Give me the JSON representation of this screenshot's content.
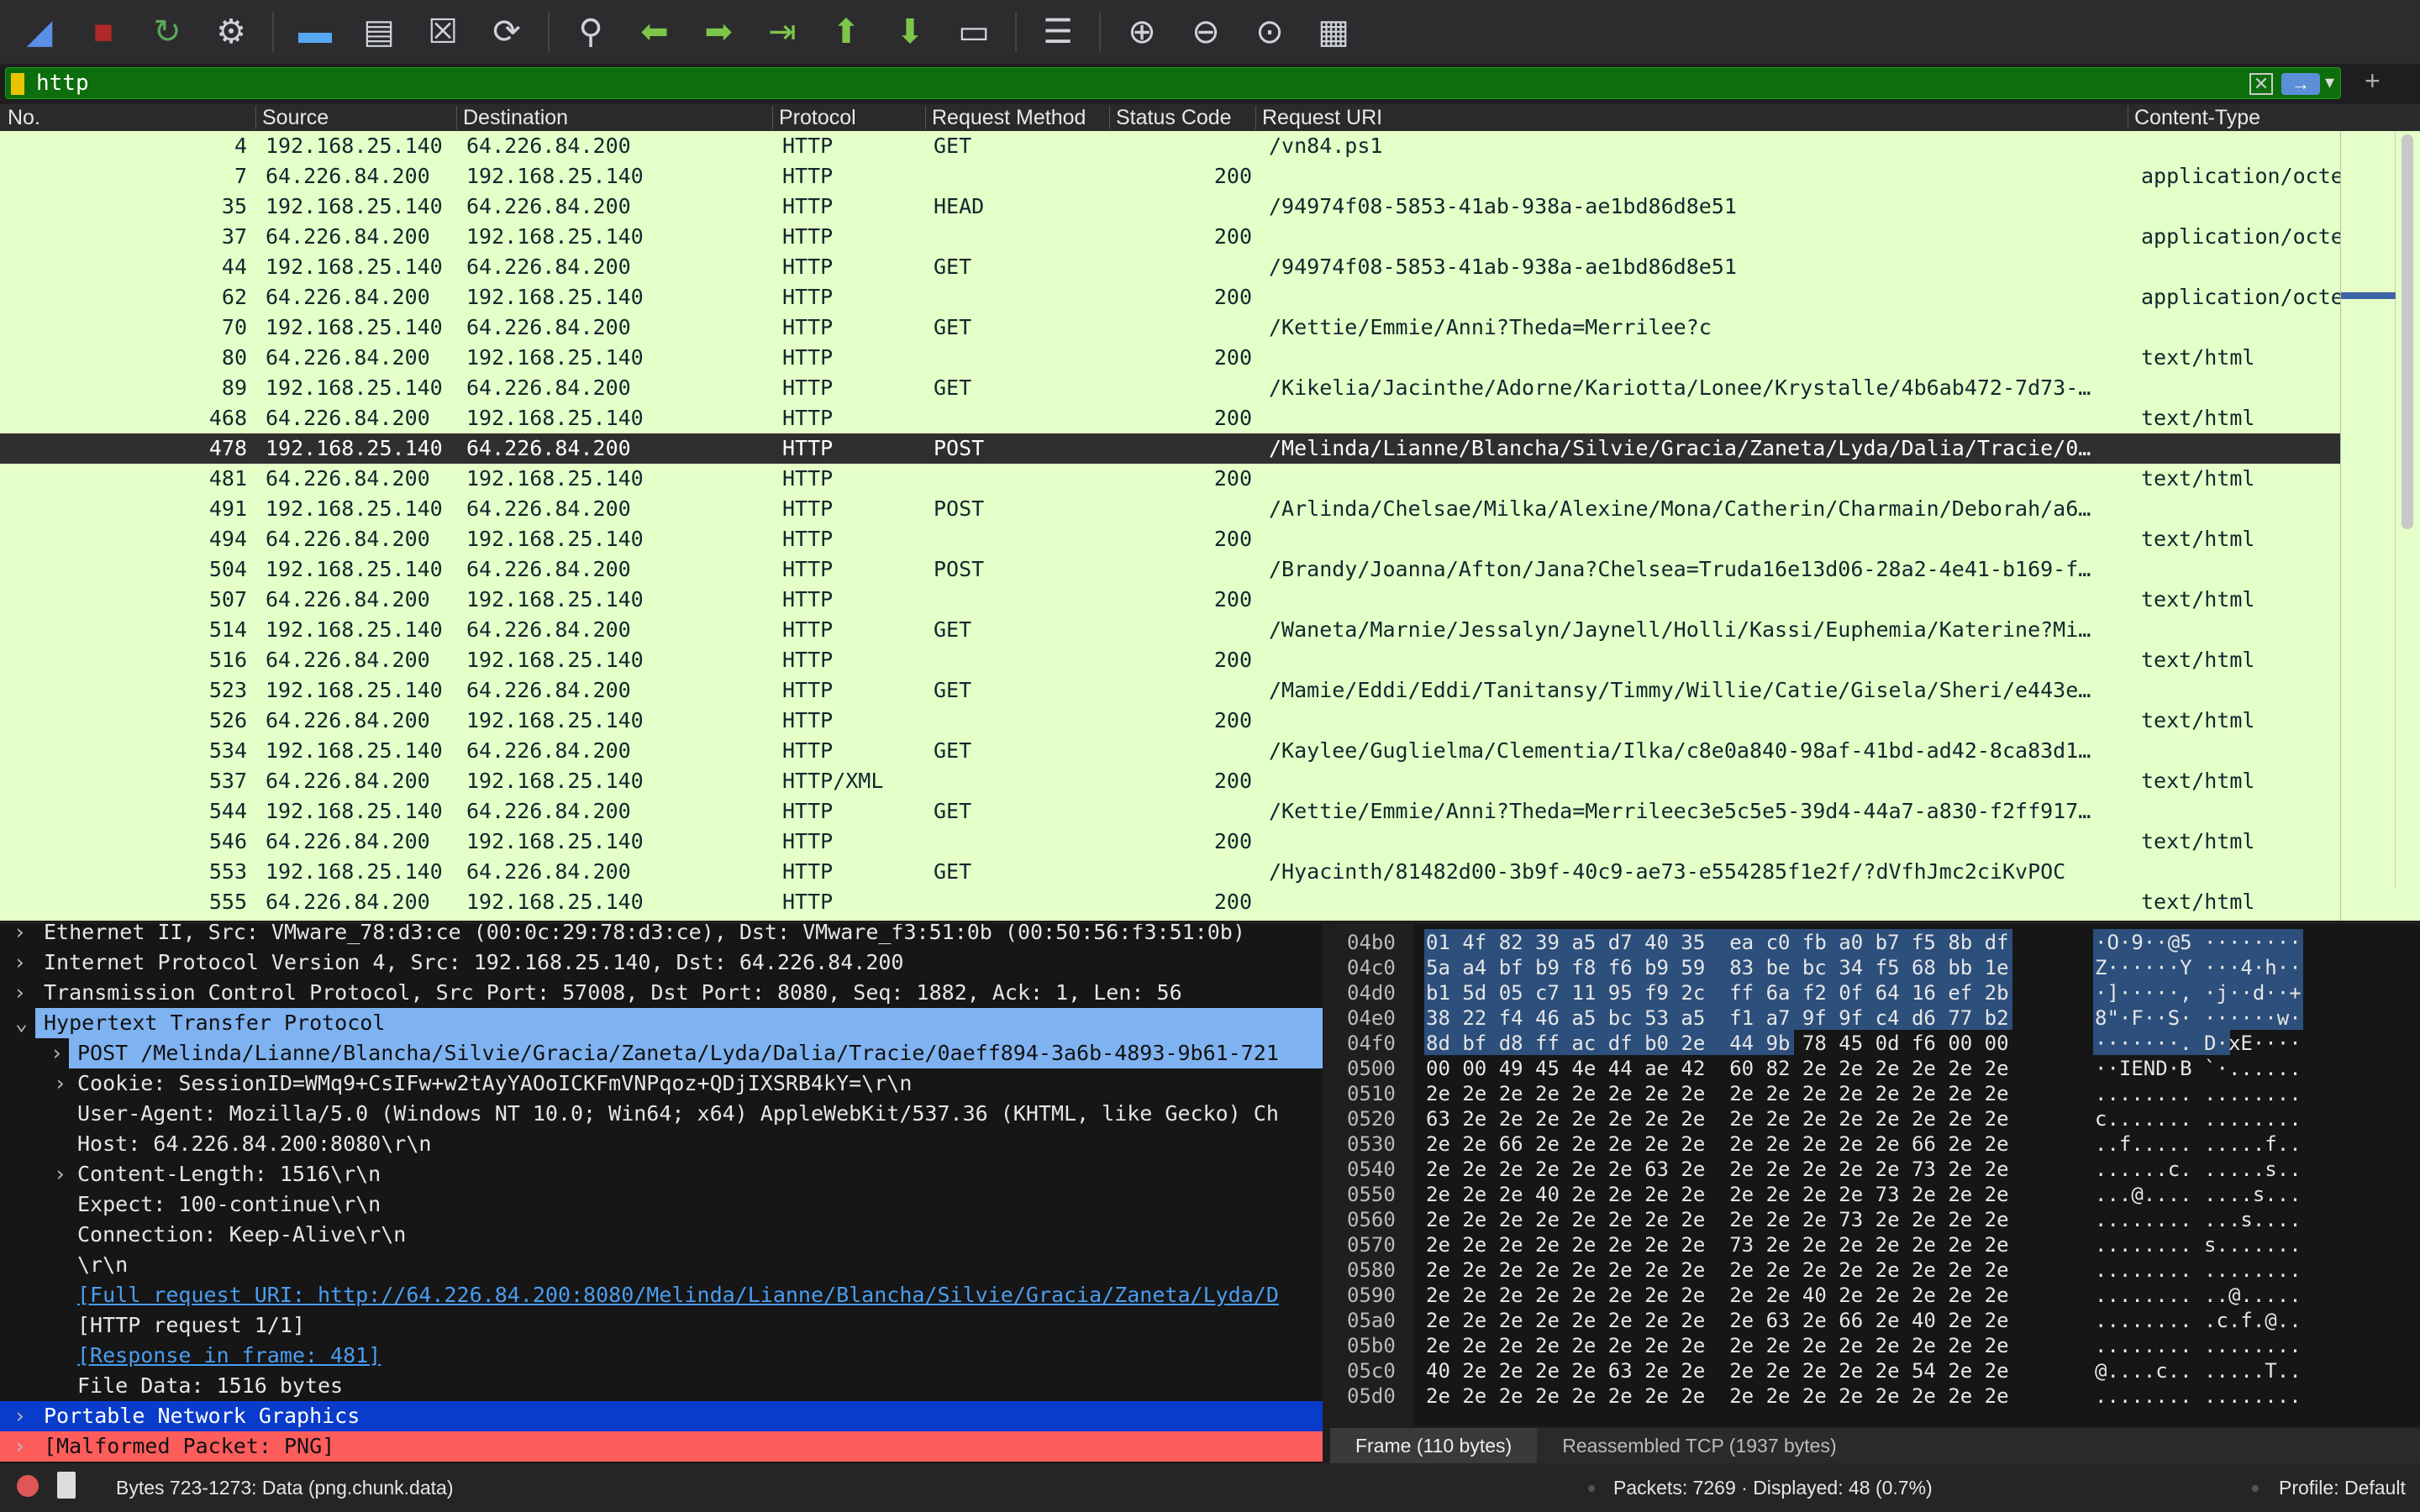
{
  "toolbar": {
    "icons": [
      "shark-fin-start-icon",
      "stop-capture-icon",
      "restart-capture-icon",
      "capture-options-gear-icon",
      "open-folder-icon",
      "save-file-icon",
      "close-file-icon",
      "reload-icon",
      "find-magnifier-icon",
      "go-back-arrow-icon",
      "go-forward-arrow-icon",
      "go-to-packet-icon",
      "first-packet-icon",
      "last-packet-icon",
      "auto-scroll-icon",
      "colorize-icon",
      "zoom-in-icon",
      "zoom-out-icon",
      "zoom-normal-icon",
      "resize-columns-icon"
    ]
  },
  "filter": {
    "value": "http",
    "clear": "✕",
    "apply": "→",
    "dropdown": "▾",
    "add": "+"
  },
  "colors": {
    "list_bg": "#e4ffc7",
    "selected_row": "#2f2f2f",
    "filter_bg": "#0c6e0c",
    "http_highlight": "#7fb2f0",
    "png_row": "#0a3ccc",
    "malformed_row": "#ff5c5c"
  },
  "columns": [
    "No.",
    "Source",
    "Destination",
    "Protocol",
    "Request Method",
    "Status Code",
    "Request URI",
    "Content-Type"
  ],
  "packets": [
    [
      "4",
      "192.168.25.140",
      "64.226.84.200",
      "HTTP",
      "GET",
      "",
      "/vn84.ps1",
      ""
    ],
    [
      "7",
      "64.226.84.200",
      "192.168.25.140",
      "HTTP",
      "",
      "200",
      "",
      "application/octe"
    ],
    [
      "35",
      "192.168.25.140",
      "64.226.84.200",
      "HTTP",
      "HEAD",
      "",
      "/94974f08-5853-41ab-938a-ae1bd86d8e51",
      ""
    ],
    [
      "37",
      "64.226.84.200",
      "192.168.25.140",
      "HTTP",
      "",
      "200",
      "",
      "application/octe"
    ],
    [
      "44",
      "192.168.25.140",
      "64.226.84.200",
      "HTTP",
      "GET",
      "",
      "/94974f08-5853-41ab-938a-ae1bd86d8e51",
      ""
    ],
    [
      "62",
      "64.226.84.200",
      "192.168.25.140",
      "HTTP",
      "",
      "200",
      "",
      "application/octe"
    ],
    [
      "70",
      "192.168.25.140",
      "64.226.84.200",
      "HTTP",
      "GET",
      "",
      "/Kettie/Emmie/Anni?Theda=Merrilee?c",
      ""
    ],
    [
      "80",
      "64.226.84.200",
      "192.168.25.140",
      "HTTP",
      "",
      "200",
      "",
      "text/html"
    ],
    [
      "89",
      "192.168.25.140",
      "64.226.84.200",
      "HTTP",
      "GET",
      "",
      "/Kikelia/Jacinthe/Adorne/Kariotta/Lonee/Krystalle/4b6ab472-7d73-…",
      ""
    ],
    [
      "468",
      "64.226.84.200",
      "192.168.25.140",
      "HTTP",
      "",
      "200",
      "",
      "text/html"
    ],
    [
      "478",
      "192.168.25.140",
      "64.226.84.200",
      "HTTP",
      "POST",
      "",
      "/Melinda/Lianne/Blancha/Silvie/Gracia/Zaneta/Lyda/Dalia/Tracie/0…",
      ""
    ],
    [
      "481",
      "64.226.84.200",
      "192.168.25.140",
      "HTTP",
      "",
      "200",
      "",
      "text/html"
    ],
    [
      "491",
      "192.168.25.140",
      "64.226.84.200",
      "HTTP",
      "POST",
      "",
      "/Arlinda/Chelsae/Milka/Alexine/Mona/Catherin/Charmain/Deborah/a6…",
      ""
    ],
    [
      "494",
      "64.226.84.200",
      "192.168.25.140",
      "HTTP",
      "",
      "200",
      "",
      "text/html"
    ],
    [
      "504",
      "192.168.25.140",
      "64.226.84.200",
      "HTTP",
      "POST",
      "",
      "/Brandy/Joanna/Afton/Jana?Chelsea=Truda16e13d06-28a2-4e41-b169-f…",
      ""
    ],
    [
      "507",
      "64.226.84.200",
      "192.168.25.140",
      "HTTP",
      "",
      "200",
      "",
      "text/html"
    ],
    [
      "514",
      "192.168.25.140",
      "64.226.84.200",
      "HTTP",
      "GET",
      "",
      "/Waneta/Marnie/Jessalyn/Jaynell/Holli/Kassi/Euphemia/Katerine?Mi…",
      ""
    ],
    [
      "516",
      "64.226.84.200",
      "192.168.25.140",
      "HTTP",
      "",
      "200",
      "",
      "text/html"
    ],
    [
      "523",
      "192.168.25.140",
      "64.226.84.200",
      "HTTP",
      "GET",
      "",
      "/Mamie/Eddi/Eddi/Tanitansy/Timmy/Willie/Catie/Gisela/Sheri/e443e…",
      ""
    ],
    [
      "526",
      "64.226.84.200",
      "192.168.25.140",
      "HTTP",
      "",
      "200",
      "",
      "text/html"
    ],
    [
      "534",
      "192.168.25.140",
      "64.226.84.200",
      "HTTP",
      "GET",
      "",
      "/Kaylee/Guglielma/Clementia/Ilka/c8e0a840-98af-41bd-ad42-8ca83d1…",
      ""
    ],
    [
      "537",
      "64.226.84.200",
      "192.168.25.140",
      "HTTP/XML",
      "",
      "200",
      "",
      "text/html"
    ],
    [
      "544",
      "192.168.25.140",
      "64.226.84.200",
      "HTTP",
      "GET",
      "",
      "/Kettie/Emmie/Anni?Theda=Merrileec3e5c5e5-39d4-44a7-a830-f2ff917…",
      ""
    ],
    [
      "546",
      "64.226.84.200",
      "192.168.25.140",
      "HTTP",
      "",
      "200",
      "",
      "text/html"
    ],
    [
      "553",
      "192.168.25.140",
      "64.226.84.200",
      "HTTP",
      "GET",
      "",
      "/Hyacinth/81482d00-3b9f-40c9-ae73-e554285f1e2f/?dVfhJmc2ciKvPOC",
      ""
    ],
    [
      "555",
      "64.226.84.200",
      "192.168.25.140",
      "HTTP",
      "",
      "200",
      "",
      "text/html"
    ]
  ],
  "selected_packet": "478",
  "details": [
    {
      "arrow": "›",
      "indent": 0,
      "text": "Ethernet II, Src: VMware_78:d3:ce (00:0c:29:78:d3:ce), Dst: VMware_f3:51:0b (00:50:56:f3:51:0b)",
      "style": ""
    },
    {
      "arrow": "›",
      "indent": 0,
      "text": "Internet Protocol Version 4, Src: 192.168.25.140, Dst: 64.226.84.200",
      "style": ""
    },
    {
      "arrow": "›",
      "indent": 0,
      "text": "Transmission Control Protocol, Src Port: 57008, Dst Port: 8080, Seq: 1882, Ack: 1, Len: 56",
      "style": ""
    },
    {
      "arrow": "⌄",
      "indent": 0,
      "text": "Hypertext Transfer Protocol",
      "style": "hl"
    },
    {
      "arrow": "›",
      "indent": 1,
      "text": "POST /Melinda/Lianne/Blancha/Silvie/Gracia/Zaneta/Lyda/Dalia/Tracie/0aeff894-3a6b-4893-9b61-721",
      "style": "sub"
    },
    {
      "arrow": "›",
      "indent": 1,
      "text": "Cookie: SessionID=WMq9+CsIFw+w2tAyYAOoICKFmVNPqoz+QDjIXSRB4kY=\\r\\n",
      "style": ""
    },
    {
      "arrow": "",
      "indent": 1,
      "text": "User-Agent: Mozilla/5.0 (Windows NT 10.0; Win64; x64) AppleWebKit/537.36 (KHTML, like Gecko) Ch",
      "style": ""
    },
    {
      "arrow": "",
      "indent": 1,
      "text": "Host: 64.226.84.200:8080\\r\\n",
      "style": ""
    },
    {
      "arrow": "›",
      "indent": 1,
      "text": "Content-Length: 1516\\r\\n",
      "style": ""
    },
    {
      "arrow": "",
      "indent": 1,
      "text": "Expect: 100-continue\\r\\n",
      "style": ""
    },
    {
      "arrow": "",
      "indent": 1,
      "text": "Connection: Keep-Alive\\r\\n",
      "style": ""
    },
    {
      "arrow": "",
      "indent": 1,
      "text": "\\r\\n",
      "style": ""
    },
    {
      "arrow": "",
      "indent": 1,
      "text": "[Full request URI: http://64.226.84.200:8080/Melinda/Lianne/Blancha/Silvie/Gracia/Zaneta/Lyda/D",
      "style": "link"
    },
    {
      "arrow": "",
      "indent": 1,
      "text": "[HTTP request 1/1]",
      "style": ""
    },
    {
      "arrow": "",
      "indent": 1,
      "text": "[Response in frame: 481]",
      "style": "link"
    },
    {
      "arrow": "",
      "indent": 1,
      "text": "File Data: 1516 bytes",
      "style": ""
    },
    {
      "arrow": "›",
      "indent": 0,
      "text": "Portable Network Graphics",
      "style": "png"
    },
    {
      "arrow": "›",
      "indent": 0,
      "text": "[Malformed Packet: PNG]",
      "style": "mal"
    }
  ],
  "hex": [
    {
      "off": "04b0",
      "hex": "01 4f 82 39 a5 d7 40 35  ea c0 fb a0 b7 f5 8b df",
      "ascii": "·O·9··@5 ········",
      "sel": 16
    },
    {
      "off": "04c0",
      "hex": "5a a4 bf b9 f8 f6 b9 59  83 be bc 34 f5 68 bb 1e",
      "ascii": "Z······Y ···4·h··",
      "sel": 16
    },
    {
      "off": "04d0",
      "hex": "b1 5d 05 c7 11 95 f9 2c  ff 6a f2 0f 64 16 ef 2b",
      "ascii": "·]·····, ·j··d··+",
      "sel": 16
    },
    {
      "off": "04e0",
      "hex": "38 22 f4 46 a5 bc 53 a5  f1 a7 9f 9f c4 d6 77 b2",
      "ascii": "8\"·F··S· ······w·",
      "sel": 16
    },
    {
      "off": "04f0",
      "hex": "8d bf d8 ff ac df b0 2e  44 9b 78 45 0d f6 00 00",
      "ascii": "·······. D·xE····",
      "sel": 10
    },
    {
      "off": "0500",
      "hex": "00 00 49 45 4e 44 ae 42  60 82 2e 2e 2e 2e 2e 2e",
      "ascii": "··IEND·B `·......",
      "sel": 0
    },
    {
      "off": "0510",
      "hex": "2e 2e 2e 2e 2e 2e 2e 2e  2e 2e 2e 2e 2e 2e 2e 2e",
      "ascii": "........ ........",
      "sel": 0
    },
    {
      "off": "0520",
      "hex": "63 2e 2e 2e 2e 2e 2e 2e  2e 2e 2e 2e 2e 2e 2e 2e",
      "ascii": "c....... ........",
      "sel": 0
    },
    {
      "off": "0530",
      "hex": "2e 2e 66 2e 2e 2e 2e 2e  2e 2e 2e 2e 2e 66 2e 2e",
      "ascii": "..f..... .....f..",
      "sel": 0
    },
    {
      "off": "0540",
      "hex": "2e 2e 2e 2e 2e 2e 63 2e  2e 2e 2e 2e 2e 73 2e 2e",
      "ascii": "......c. .....s..",
      "sel": 0
    },
    {
      "off": "0550",
      "hex": "2e 2e 2e 40 2e 2e 2e 2e  2e 2e 2e 2e 73 2e 2e 2e",
      "ascii": "...@.... ....s...",
      "sel": 0
    },
    {
      "off": "0560",
      "hex": "2e 2e 2e 2e 2e 2e 2e 2e  2e 2e 2e 73 2e 2e 2e 2e",
      "ascii": "........ ...s....",
      "sel": 0
    },
    {
      "off": "0570",
      "hex": "2e 2e 2e 2e 2e 2e 2e 2e  73 2e 2e 2e 2e 2e 2e 2e",
      "ascii": "........ s.......",
      "sel": 0
    },
    {
      "off": "0580",
      "hex": "2e 2e 2e 2e 2e 2e 2e 2e  2e 2e 2e 2e 2e 2e 2e 2e",
      "ascii": "........ ........",
      "sel": 0
    },
    {
      "off": "0590",
      "hex": "2e 2e 2e 2e 2e 2e 2e 2e  2e 2e 40 2e 2e 2e 2e 2e",
      "ascii": "........ ..@.....",
      "sel": 0
    },
    {
      "off": "05a0",
      "hex": "2e 2e 2e 2e 2e 2e 2e 2e  2e 63 2e 66 2e 40 2e 2e",
      "ascii": "........ .c.f.@..",
      "sel": 0
    },
    {
      "off": "05b0",
      "hex": "2e 2e 2e 2e 2e 2e 2e 2e  2e 2e 2e 2e 2e 2e 2e 2e",
      "ascii": "........ ........",
      "sel": 0
    },
    {
      "off": "05c0",
      "hex": "40 2e 2e 2e 2e 63 2e 2e  2e 2e 2e 2e 2e 54 2e 2e",
      "ascii": "@....c.. .....T..",
      "sel": 0
    },
    {
      "off": "05d0",
      "hex": "2e 2e 2e 2e 2e 2e 2e 2e  2e 2e 2e 2e 2e 2e 2e 2e",
      "ascii": "........ ........",
      "sel": 0
    }
  ],
  "byte_tabs": [
    "Frame (110 bytes)",
    "Reassembled TCP (1937 bytes)"
  ],
  "status": {
    "field": "Bytes 723-1273: Data (png.chunk.data)",
    "packets": "Packets: 7269 · Displayed: 48 (0.7%)",
    "profile": "Profile: Default"
  }
}
